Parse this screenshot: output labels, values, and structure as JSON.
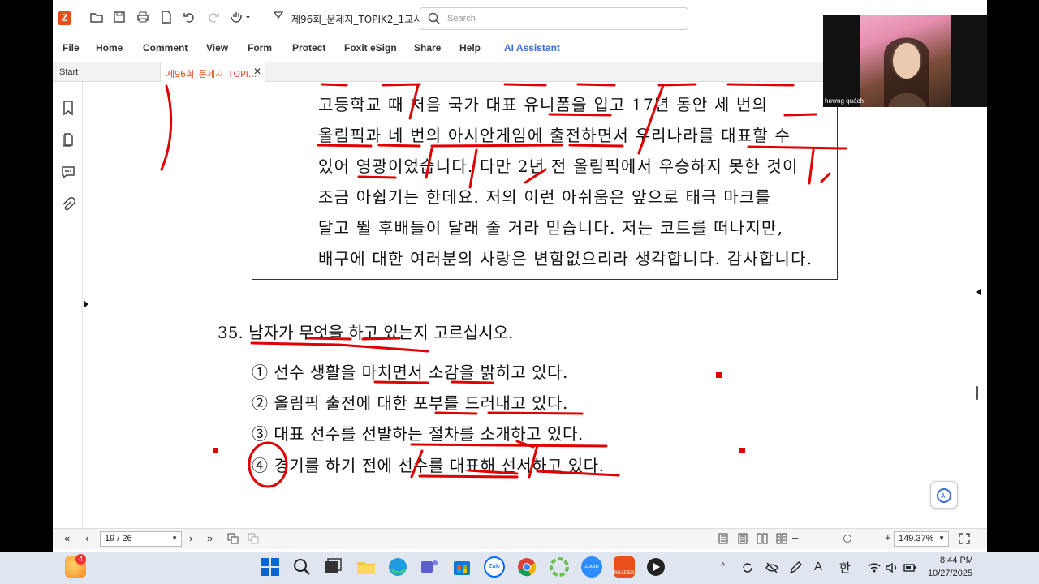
{
  "app": {
    "doc_title": "제96회_문제지_TOPIK2_1교시_...",
    "search_placeholder": "Search"
  },
  "menu": [
    "File",
    "Home",
    "Comment",
    "View",
    "Form",
    "Protect",
    "Foxit eSign",
    "Share",
    "Help",
    "AI Assistant"
  ],
  "tabs": {
    "start_label": "Start",
    "doc_label": "제96회_문제지_TOPI..."
  },
  "passage": {
    "lines": [
      "고등학교 때 처음 국가 대표 유니폼을 입고 17년 동안 세 번의",
      "올림픽과 네 번의 아시안게임에 출전하면서 우리나라를 대표할 수",
      "있어 영광이었습니다. 다만 2년 전 올림픽에서 우승하지 못한 것이",
      "조금 아쉽기는 한데요. 저의 이런 아쉬움은 앞으로 태극 마크를",
      "달고 뛸 후배들이 달래 줄 거라 믿습니다. 저는 코트를 떠나지만,",
      "배구에 대한 여러분의 사랑은 변함없으리라 생각합니다. 감사합니다."
    ]
  },
  "question": {
    "title": "35. 남자가 무엇을 하고 있는지 고르십시오.",
    "options": [
      "① 선수 생활을 마치면서 소감을 밝히고 있다.",
      "② 올림픽 출전에 대한 포부를 드러내고 있다.",
      "③ 대표 선수를 선발하는 절차를 소개하고 있다.",
      "④ 경기를 하기 전에 선수를 대표해 선서하고 있다."
    ]
  },
  "status": {
    "page": "19 / 26",
    "zoom": "149.37%"
  },
  "webcam": {
    "name": "hương quách"
  },
  "taskbar": {
    "badge": "4",
    "ime": "A",
    "lang": "한",
    "time": "8:44 PM",
    "date": "10/27/2025"
  },
  "colors": {
    "ink": "#e00000",
    "brand": "#e94e1b",
    "ai": "#3b6fd8"
  }
}
